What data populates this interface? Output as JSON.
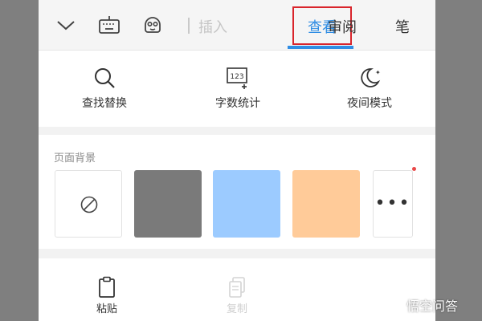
{
  "toolbar": {
    "tabs": [
      {
        "label": "插入",
        "state": "faded"
      },
      {
        "label": "查看",
        "state": "active"
      },
      {
        "label": "审阅",
        "state": "normal"
      },
      {
        "label": "笔",
        "state": "normal"
      }
    ],
    "icons": [
      "chevron-down-icon",
      "keyboard-icon",
      "assistant-face-icon"
    ],
    "active_color": "#2f8de4",
    "highlight_color": "#d9242b"
  },
  "tools": [
    {
      "label": "查找替换",
      "icon": "search-icon"
    },
    {
      "label": "字数统计",
      "icon": "word-count-icon",
      "icon_text": "123"
    },
    {
      "label": "夜间模式",
      "icon": "night-mode-icon"
    }
  ],
  "background_section": {
    "title": "页面背景",
    "swatches": [
      {
        "name": "none",
        "color": "#ffffff",
        "icon": "no-background-icon"
      },
      {
        "name": "gray",
        "color": "#7a7a7a"
      },
      {
        "name": "blue",
        "color": "#9ccbff"
      },
      {
        "name": "orange",
        "color": "#ffcb99"
      }
    ],
    "more_label": "•••"
  },
  "bottom_actions": [
    {
      "label": "粘贴",
      "icon": "clipboard-icon",
      "enabled": true
    },
    {
      "label": "复制",
      "icon": "copy-icon",
      "enabled": false
    }
  ],
  "watermark": {
    "text": "悟空问答"
  }
}
